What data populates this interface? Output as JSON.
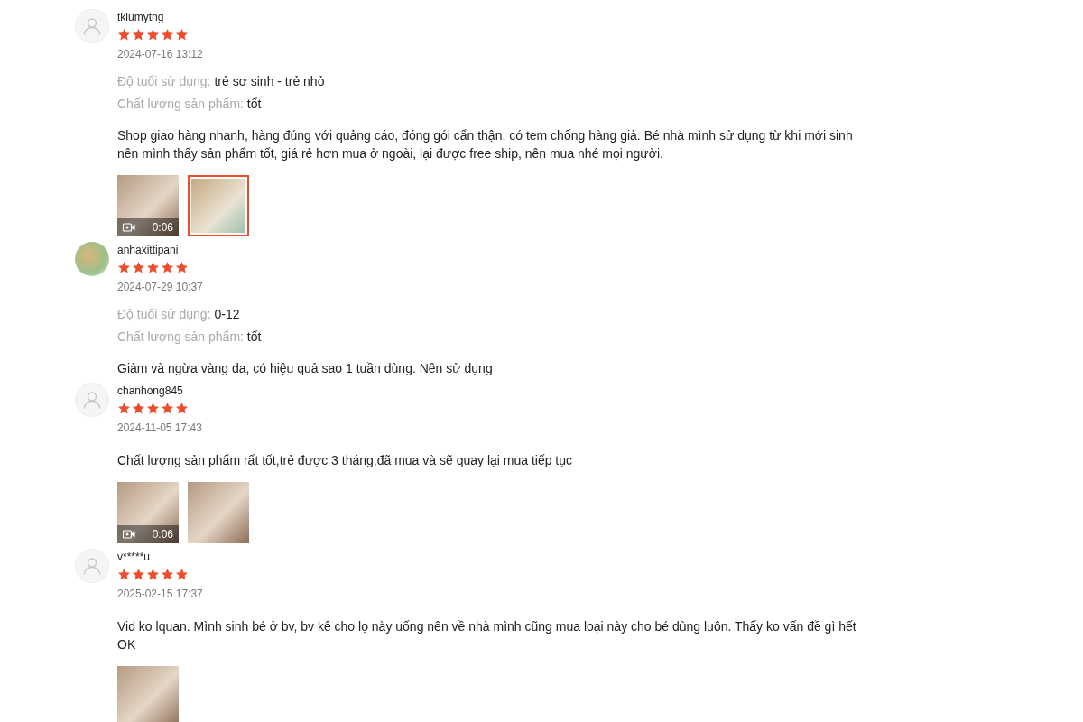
{
  "reviews": [
    {
      "kind": "default-avatar",
      "username": "tkiumytng",
      "stars": 5,
      "date": "2024-07-16 13:12",
      "attributes": [
        {
          "label": "Độ tuổi sử dụng:",
          "value": "trẻ sơ sinh - trẻ nhỏ"
        },
        {
          "label": "Chất lượng sản phẩm:",
          "value": "tốt"
        }
      ],
      "text": "Shop giao hàng nhanh, hàng đúng với quảng cáo, đóng gói cẩn thận, có tem chống hàng giả. Bé nhà mình sử dụng từ khi mới sinh nên mình thấy sản phẩm tốt, giá rẻ hơn mua ở ngoài, lại được free ship, nên mua nhé mọi người.",
      "media": [
        {
          "kind": "video",
          "duration": "0:06",
          "selected": false
        },
        {
          "kind": "photo",
          "selected": true
        }
      ]
    },
    {
      "kind": "picture-avatar",
      "username": "anhaxittipani",
      "stars": 5,
      "date": "2024-07-29 10:37",
      "attributes": [
        {
          "label": "Độ tuổi sử dụng:",
          "value": "0-12"
        },
        {
          "label": "Chất lượng sản phẩm:",
          "value": "tốt"
        }
      ],
      "text": "Giảm và ngừa vàng da, có hiệu quả sao 1 tuần dùng. Nên sử dụng"
    },
    {
      "kind": "default-avatar",
      "username": "chanhong845",
      "stars": 5,
      "date": "2024-11-05 17:43",
      "text": "Chất lượng sản phẩm rất tốt,trẻ được 3 tháng,đã mua và sẽ quay lại mua tiếp tục",
      "media": [
        {
          "kind": "video",
          "duration": "0:06",
          "selected": false
        },
        {
          "kind": "photo",
          "selected": false
        }
      ]
    },
    {
      "kind": "default-avatar",
      "username": "v*****u",
      "stars": 5,
      "date": "2025-02-15 17:37",
      "text": "Vid ko lquan. Mình sinh bé ở bv, bv kê cho lọ này uống nên về nhà mình cũng mua loại này cho bé dùng luôn. Thấy ko vấn đề gì hết OK",
      "media": [
        {
          "kind": "photo",
          "selected": false
        }
      ]
    }
  ]
}
